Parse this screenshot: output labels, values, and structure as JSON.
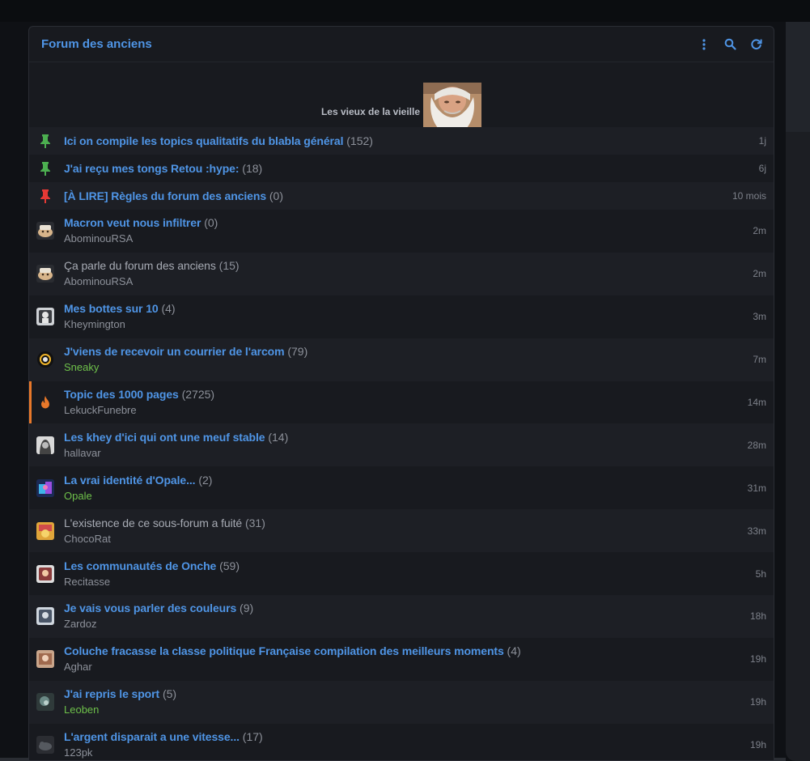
{
  "forum": {
    "title": "Forum des anciens",
    "banner_text": "Les vieux de la vieille",
    "colors": {
      "accent": "#4f95e6",
      "green": "#6ec04a",
      "pin_green": "#4caf50",
      "pin_red": "#e53935",
      "hot": "#e8782a"
    }
  },
  "header_icons": [
    "more-vertical-icon",
    "search-icon",
    "refresh-icon"
  ],
  "pinned": [
    {
      "title": "Ici on compile les topics qualitatifs du blabla général",
      "count": "(152)",
      "time": "1j",
      "pin": "green"
    },
    {
      "title": "J'ai reçu mes tongs Retou :hype:",
      "count": "(18)",
      "time": "6j",
      "pin": "green"
    },
    {
      "title": "[À LIRE] Règles du forum des anciens",
      "count": "(0)",
      "time": "10 mois",
      "pin": "red"
    }
  ],
  "topics": [
    {
      "title": "Macron veut nous infiltrer",
      "count": "(0)",
      "author": "AbominouRSA",
      "time": "2m"
    },
    {
      "title": "Ça parle du forum des anciens",
      "count": "(15)",
      "author": "AbominouRSA",
      "time": "2m"
    },
    {
      "title": "Mes bottes sur 10",
      "count": "(4)",
      "author": "Kheymington",
      "time": "3m"
    },
    {
      "title": "J'viens de recevoir un courrier de l'arcom",
      "count": "(79)",
      "author": "Sneaky",
      "time": "7m"
    },
    {
      "title": "Topic des 1000 pages",
      "count": "(2725)",
      "author": "LekuckFunebre",
      "time": "14m"
    },
    {
      "title": "Les khey d'ici qui ont une meuf stable",
      "count": "(14)",
      "author": "hallavar",
      "time": "28m"
    },
    {
      "title": "La vrai identité d'Opale...",
      "count": "(2)",
      "author": "Opale",
      "time": "31m"
    },
    {
      "title": "L'existence de ce sous-forum a fuité",
      "count": "(31)",
      "author": "ChocoRat",
      "time": "33m"
    },
    {
      "title": "Les communautés de Onche",
      "count": "(59)",
      "author": "Recitasse",
      "time": "5h"
    },
    {
      "title": "Je vais vous parler des couleurs",
      "count": "(9)",
      "author": "Zardoz",
      "time": "18h"
    },
    {
      "title": "Coluche fracasse la classe politique Française compilation des meilleurs moments",
      "count": "(4)",
      "author": "Aghar",
      "time": "19h"
    },
    {
      "title": "J'ai repris le sport",
      "count": "(5)",
      "author": "Leoben",
      "time": "19h"
    },
    {
      "title": "L'argent disparait a une vitesse...",
      "count": "(17)",
      "author": "123pk",
      "time": "19h"
    }
  ]
}
